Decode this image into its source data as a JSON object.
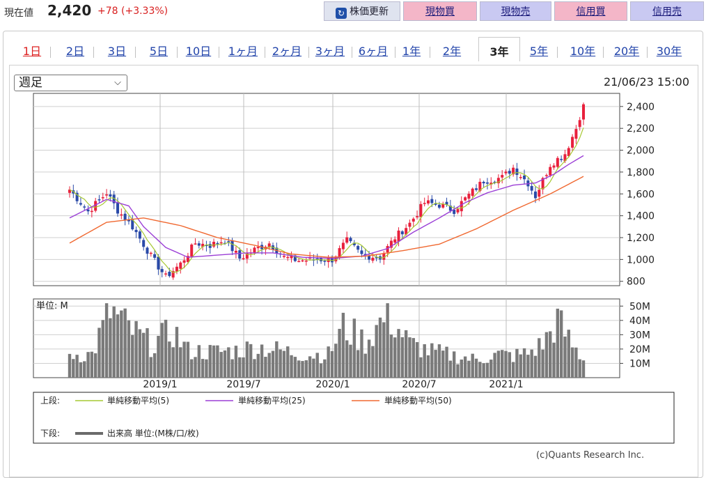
{
  "header": {
    "price_label": "現在値",
    "price_value": "2,420",
    "price_change": "+78 (+3.33%)",
    "refresh_label": "株価更新",
    "buy_label": "現物買",
    "sell_label": "現物売",
    "margin_buy_label": "信用買",
    "margin_sell_label": "信用売"
  },
  "tabs": [
    "1日",
    "2日",
    "3日",
    "5日",
    "10日",
    "1ヶ月",
    "2ヶ月",
    "3ヶ月",
    "6ヶ月",
    "1年",
    "2年",
    "3年",
    "5年",
    "10年",
    "20年",
    "30年"
  ],
  "selected_tab": "3年",
  "period_select": "週足",
  "datetime": "21/06/23 15:00",
  "legend": {
    "upper_label": "上段:",
    "lower_label": "下段:",
    "ma5": "単純移動平均(5)",
    "ma25": "単純移動平均(25)",
    "ma50": "単純移動平均(50)",
    "volume": "出来高 単位:(M株/口/枚)"
  },
  "volume_unit_label": "単位: M",
  "copyright": "(c)Quants Research Inc.",
  "colors": {
    "up": "#e8203c",
    "down": "#2a4aa8",
    "ma5": "#a6c832",
    "ma25": "#9b3fd6",
    "ma50": "#f06830",
    "volume": "#7a7a7a"
  },
  "chart_data": {
    "type": "candlestick",
    "x_tick_labels": [
      "2019/1",
      "2019/7",
      "2020/1",
      "2020/7",
      "2021/1"
    ],
    "x_range": [
      "2018/07",
      "2021/06"
    ],
    "price_axis": {
      "ticks": [
        800,
        1000,
        1200,
        1400,
        1600,
        1800,
        2000,
        2200,
        2400
      ],
      "range": [
        760,
        2520
      ]
    },
    "volume_axis": {
      "ticks_labels": [
        "10M",
        "20M",
        "30M",
        "40M",
        "50M"
      ],
      "ticks": [
        10,
        20,
        30,
        40,
        50
      ],
      "range": [
        0,
        55
      ]
    },
    "close_trajectory": [
      [
        0,
        1640
      ],
      [
        5,
        1440
      ],
      [
        10,
        1610
      ],
      [
        13,
        1450
      ],
      [
        17,
        1300
      ],
      [
        22,
        1030
      ],
      [
        26,
        840
      ],
      [
        30,
        960
      ],
      [
        34,
        1150
      ],
      [
        38,
        1130
      ],
      [
        42,
        1180
      ],
      [
        46,
        1010
      ],
      [
        50,
        1090
      ],
      [
        54,
        1150
      ],
      [
        58,
        1020
      ],
      [
        62,
        990
      ],
      [
        67,
        1000
      ],
      [
        71,
        1000
      ],
      [
        75,
        1170
      ],
      [
        79,
        1040
      ],
      [
        84,
        1020
      ],
      [
        88,
        1200
      ],
      [
        92,
        1330
      ],
      [
        96,
        1520
      ],
      [
        100,
        1500
      ],
      [
        104,
        1450
      ],
      [
        108,
        1590
      ],
      [
        112,
        1720
      ],
      [
        117,
        1750
      ],
      [
        120,
        1840
      ],
      [
        124,
        1700
      ],
      [
        126,
        1580
      ],
      [
        130,
        1870
      ],
      [
        134,
        1970
      ],
      [
        137,
        2200
      ],
      [
        139,
        2420
      ]
    ],
    "ma_series": [
      {
        "name": "単純移動平均(5)",
        "key": "ma5"
      },
      {
        "name": "単純移動平均(25)",
        "key": "ma25",
        "points": [
          [
            0,
            1380
          ],
          [
            10,
            1550
          ],
          [
            16,
            1490
          ],
          [
            20,
            1300
          ],
          [
            26,
            1110
          ],
          [
            32,
            1020
          ],
          [
            40,
            1040
          ],
          [
            48,
            1060
          ],
          [
            55,
            1060
          ],
          [
            63,
            1020
          ],
          [
            71,
            1010
          ],
          [
            79,
            1030
          ],
          [
            86,
            1100
          ],
          [
            93,
            1250
          ],
          [
            100,
            1380
          ],
          [
            107,
            1520
          ],
          [
            113,
            1610
          ],
          [
            120,
            1680
          ],
          [
            126,
            1700
          ],
          [
            131,
            1780
          ],
          [
            135,
            1870
          ],
          [
            139,
            1950
          ]
        ]
      },
      {
        "name": "単純移動平均(50)",
        "key": "ma50",
        "points": [
          [
            0,
            1150
          ],
          [
            10,
            1340
          ],
          [
            20,
            1380
          ],
          [
            30,
            1310
          ],
          [
            40,
            1200
          ],
          [
            50,
            1130
          ],
          [
            60,
            1050
          ],
          [
            70,
            1020
          ],
          [
            80,
            1030
          ],
          [
            90,
            1080
          ],
          [
            100,
            1140
          ],
          [
            110,
            1280
          ],
          [
            120,
            1450
          ],
          [
            130,
            1600
          ],
          [
            139,
            1760
          ]
        ]
      }
    ],
    "volume_trajectory": [
      [
        0,
        18
      ],
      [
        6,
        18
      ],
      [
        11,
        52
      ],
      [
        16,
        38
      ],
      [
        22,
        26
      ],
      [
        28,
        36
      ],
      [
        32,
        21
      ],
      [
        38,
        20
      ],
      [
        45,
        21
      ],
      [
        51,
        24
      ],
      [
        57,
        21
      ],
      [
        64,
        18
      ],
      [
        70,
        18
      ],
      [
        74,
        39
      ],
      [
        80,
        28
      ],
      [
        86,
        49
      ],
      [
        92,
        26
      ],
      [
        98,
        20
      ],
      [
        104,
        17
      ],
      [
        110,
        14
      ],
      [
        116,
        18
      ],
      [
        120,
        17
      ],
      [
        124,
        19
      ],
      [
        128,
        26
      ],
      [
        132,
        44
      ],
      [
        136,
        25
      ],
      [
        139,
        14
      ]
    ]
  }
}
